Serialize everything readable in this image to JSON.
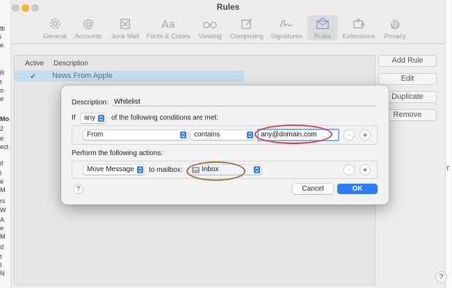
{
  "window": {
    "title": "Rules",
    "traffic_colors": [
      "#c9c9c9",
      "#f5b62f",
      "#c9c9c9"
    ]
  },
  "toolbar": {
    "items": [
      {
        "label": "General",
        "icon": "gear-icon"
      },
      {
        "label": "Accounts",
        "icon": "at-sign-icon"
      },
      {
        "label": "Junk Mail",
        "icon": "junk-mail-icon"
      },
      {
        "label": "Fonts & Colors",
        "icon": "font-icon"
      },
      {
        "label": "Viewing",
        "icon": "glasses-icon"
      },
      {
        "label": "Composing",
        "icon": "compose-icon"
      },
      {
        "label": "Signatures",
        "icon": "signature-icon"
      },
      {
        "label": "Rules",
        "icon": "rules-envelope-icon",
        "active": true
      },
      {
        "label": "Extensions",
        "icon": "puzzle-icon"
      },
      {
        "label": "Privacy",
        "icon": "hand-icon"
      }
    ]
  },
  "rules_table": {
    "columns": [
      "Active",
      "Description"
    ],
    "rows": [
      {
        "active": true,
        "check_mark": "✓",
        "description": "News From Apple"
      }
    ]
  },
  "side_buttons": {
    "add_rule": "Add Rule",
    "edit": "Edit",
    "duplicate": "Duplicate",
    "remove": "Remove"
  },
  "bottom_help": "?",
  "background_window": {
    "left_fragments": [
      "tti",
      "i",
      "e",
      "R",
      "t",
      "o",
      "e",
      "Mo",
      "2",
      "e",
      "ect",
      "if",
      "l",
      "e",
      "M",
      "rs",
      "W",
      "A",
      "e",
      "M",
      "d",
      "t",
      "I",
      "N"
    ],
    "right_fragment": "t'"
  },
  "dialog": {
    "description_label": "Description:",
    "description_value": "Whitelist",
    "if_label": "If",
    "match_mode": "any",
    "conditions_label": "of the following conditions are met:",
    "condition": {
      "field": "From",
      "operator": "contains",
      "value": "any@domain.com",
      "remove_label": "−",
      "add_label": "+"
    },
    "actions_label": "Perform the following actions:",
    "action": {
      "type": "Move Message",
      "connector": "to mailbox:",
      "mailbox": "Inbox",
      "remove_label": "−",
      "add_label": "+"
    },
    "help_label": "?",
    "cancel_label": "Cancel",
    "ok_label": "OK"
  },
  "colors": {
    "accent": "#2f7cf6",
    "annotation_red": "#d9394a",
    "annotation_brown": "#a0703a",
    "selection": "#c6dcef"
  }
}
